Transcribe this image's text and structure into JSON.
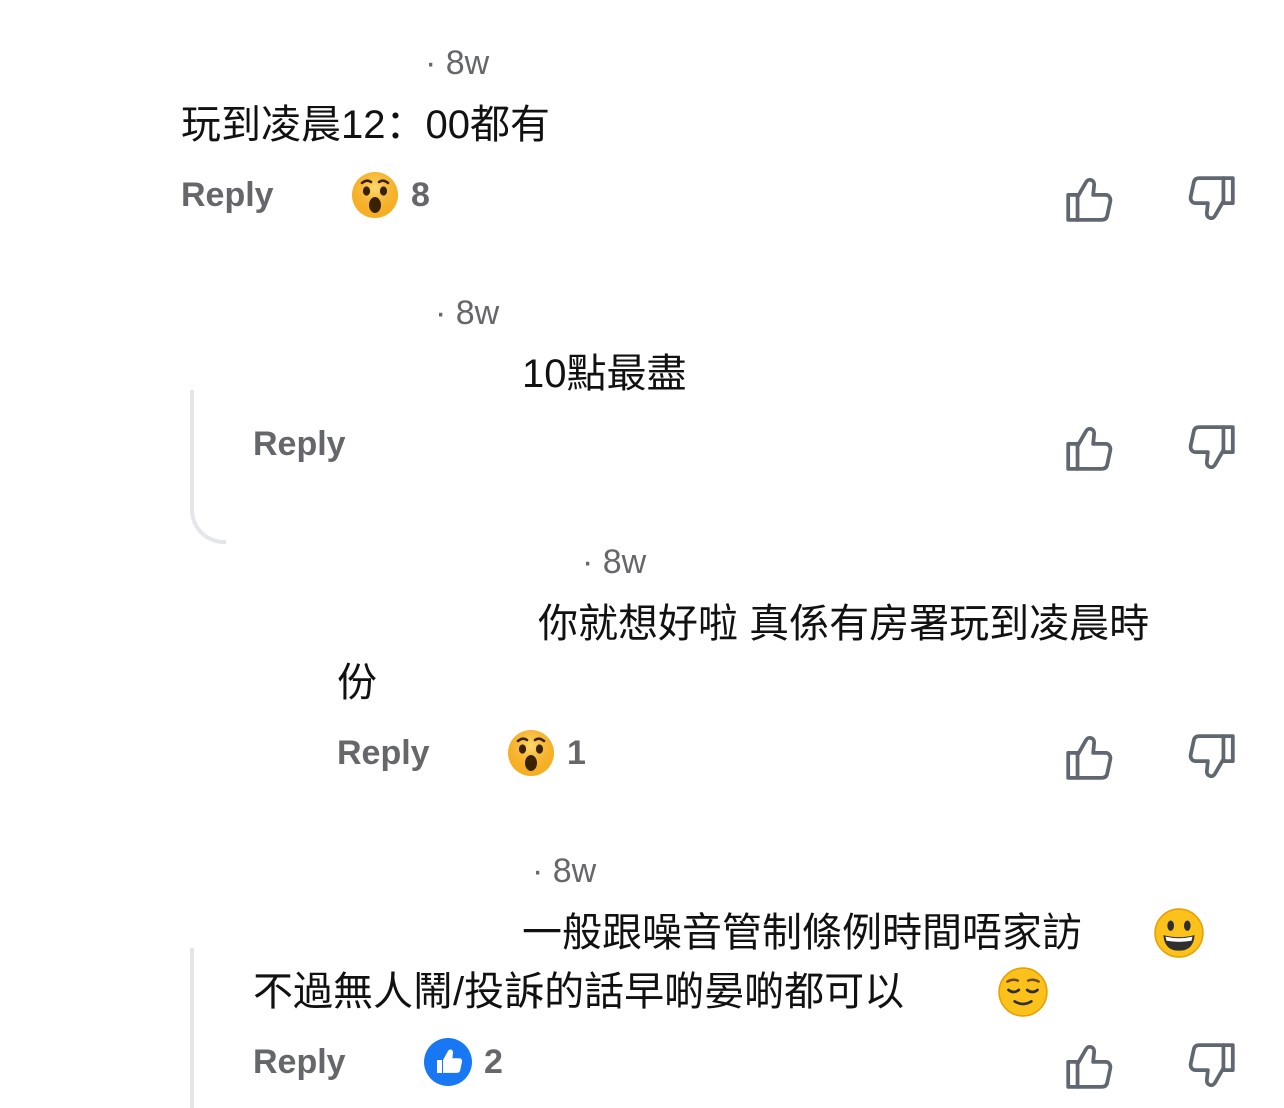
{
  "comments": [
    {
      "time": "· 8w",
      "text_lines": [
        "玩到凌晨12：00都有"
      ],
      "reply_label": "Reply",
      "reaction": {
        "icon": "wow-emoji-icon",
        "count": "8"
      }
    },
    {
      "time": "· 8w",
      "text_lines": [
        "10點最盡"
      ],
      "reply_label": "Reply"
    },
    {
      "time": "· 8w",
      "text_lines": [
        "你就想好啦 真係有房署玩到凌晨時",
        "份"
      ],
      "reply_label": "Reply",
      "reaction": {
        "icon": "wow-emoji-icon",
        "count": "1"
      }
    },
    {
      "time": "· 8w",
      "text_lines": [
        "一般跟噪音管制條例時間唔家訪",
        "不過無人鬧/投訴的話早啲晏啲都可以"
      ],
      "text_emojis": [
        "grinning-face-icon",
        "relieved-face-icon"
      ],
      "reply_label": "Reply",
      "reaction": {
        "icon": "like-icon",
        "count": "2"
      }
    }
  ],
  "colors": {
    "meta": "#65676b",
    "text": "#111111",
    "like_blue": "#1877f2",
    "thread_line": "#e4e6eb"
  }
}
